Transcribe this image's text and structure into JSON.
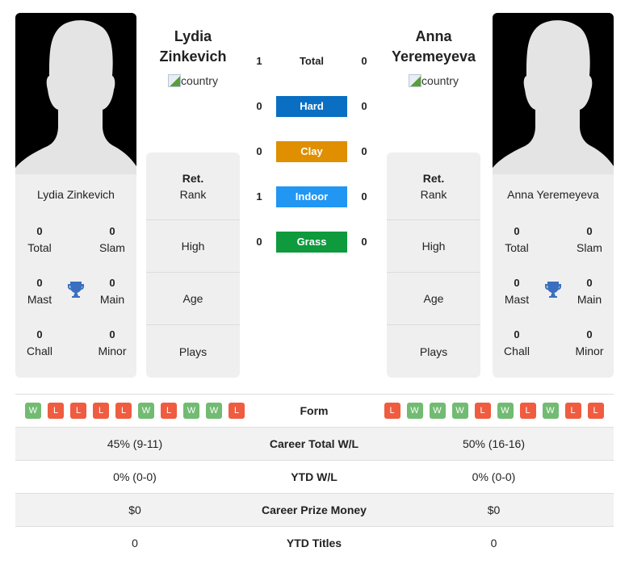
{
  "colors": {
    "hard": "#0a6fc2",
    "clay": "#df8f00",
    "indoor": "#2196f3",
    "grass": "#0e9a3d",
    "win": "#72bb72",
    "loss": "#ef5c40",
    "trophy": "#3a6fbf"
  },
  "player1": {
    "header_name_line1": "Lydia",
    "header_name_line2": "Zinkevich",
    "country_alt": "country",
    "card_name": "Lydia Zinkevich",
    "titles": {
      "total": {
        "value": "0",
        "label": "Total"
      },
      "slam": {
        "value": "0",
        "label": "Slam"
      },
      "mast": {
        "value": "0",
        "label": "Mast"
      },
      "main": {
        "value": "0",
        "label": "Main"
      },
      "chall": {
        "value": "0",
        "label": "Chall"
      },
      "minor": {
        "value": "0",
        "label": "Minor"
      }
    },
    "info": {
      "rank_top": "Ret.",
      "rank_label": "Rank",
      "high": "High",
      "age": "Age",
      "plays": "Plays"
    },
    "form": [
      "W",
      "L",
      "L",
      "L",
      "L",
      "W",
      "L",
      "W",
      "W",
      "L"
    ]
  },
  "player2": {
    "header_name_line1": "Anna",
    "header_name_line2": "Yeremeyeva",
    "country_alt": "country",
    "card_name": "Anna Yeremeyeva",
    "titles": {
      "total": {
        "value": "0",
        "label": "Total"
      },
      "slam": {
        "value": "0",
        "label": "Slam"
      },
      "mast": {
        "value": "0",
        "label": "Mast"
      },
      "main": {
        "value": "0",
        "label": "Main"
      },
      "chall": {
        "value": "0",
        "label": "Chall"
      },
      "minor": {
        "value": "0",
        "label": "Minor"
      }
    },
    "info": {
      "rank_top": "Ret.",
      "rank_label": "Rank",
      "high": "High",
      "age": "Age",
      "plays": "Plays"
    },
    "form": [
      "L",
      "W",
      "W",
      "W",
      "L",
      "W",
      "L",
      "W",
      "L",
      "L"
    ]
  },
  "h2h": [
    {
      "label": "Total",
      "p1": "1",
      "p2": "0"
    },
    {
      "label": "Hard",
      "p1": "0",
      "p2": "0"
    },
    {
      "label": "Clay",
      "p1": "0",
      "p2": "0"
    },
    {
      "label": "Indoor",
      "p1": "1",
      "p2": "0"
    },
    {
      "label": "Grass",
      "p1": "0",
      "p2": "0"
    }
  ],
  "table": {
    "form_label": "Form",
    "rows": [
      {
        "label": "Career Total W/L",
        "p1": "45% (9-11)",
        "p2": "50% (16-16)"
      },
      {
        "label": "YTD W/L",
        "p1": "0% (0-0)",
        "p2": "0% (0-0)"
      },
      {
        "label": "Career Prize Money",
        "p1": "$0",
        "p2": "$0"
      },
      {
        "label": "YTD Titles",
        "p1": "0",
        "p2": "0"
      }
    ]
  }
}
